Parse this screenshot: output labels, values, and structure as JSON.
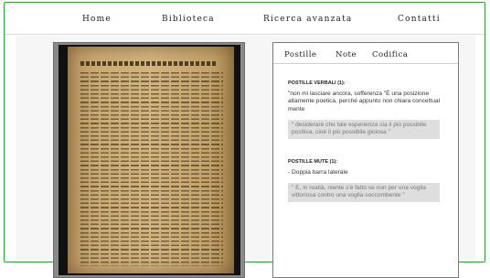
{
  "nav": {
    "home": "Home",
    "biblioteca": "Biblioteca",
    "ricerca": "Ricerca avanzata",
    "contatti": "Contatti"
  },
  "panel": {
    "tabs": [
      "Postille",
      "Note",
      "Codifica"
    ],
    "verbali_title": "POSTILLE VERBALI (1):",
    "verbali_text": "\"non mi lasciare ancora, sofferenza \"È una posizione altamente poetica, perché appunto non chiara concettual mente",
    "verbali_quote": "\" desiderare che tale esperienza sia il più possibile positiva, cioè il più possibile gioiosa \"",
    "mute_title": "POSTILLE MUTE (1):",
    "mute_text": "- Doppia barra laterale",
    "mute_quote": "\" E, in realtà, niente s'è fatto se non per una voglia vittoriosa contro una voglia soccombente \""
  }
}
